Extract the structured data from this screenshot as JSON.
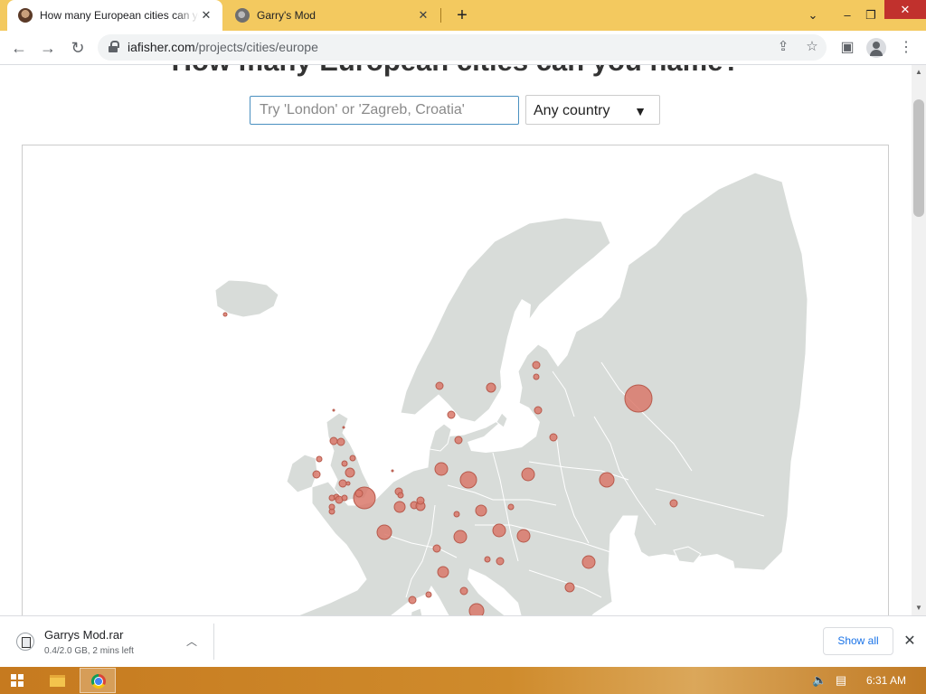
{
  "browser": {
    "tabs": [
      {
        "title": "How many European cities can you name?",
        "favicon": "site-avatar-icon",
        "active": true
      },
      {
        "title": "Garry's Mod",
        "favicon": "garrys-mod-icon",
        "active": false
      }
    ],
    "url_host": "iafisher.com",
    "url_path": "/projects/cities/europe",
    "accent": "#f3c95f"
  },
  "page": {
    "heading": "How many European cities can you name?",
    "search_placeholder": "Try 'London' or 'Zagreb, Croatia'",
    "country_select": "Any country",
    "colors": {
      "land": "#d8dcd9",
      "border": "#ffffff",
      "city_fill": "#d9786a",
      "city_stroke": "#b75a4c"
    }
  },
  "downloads": {
    "file_name": "Garrys Mod.rar",
    "status": "0.4/2.0 GB, 2 mins left",
    "show_all": "Show all"
  },
  "taskbar": {
    "clock": "6:31 AM"
  }
}
